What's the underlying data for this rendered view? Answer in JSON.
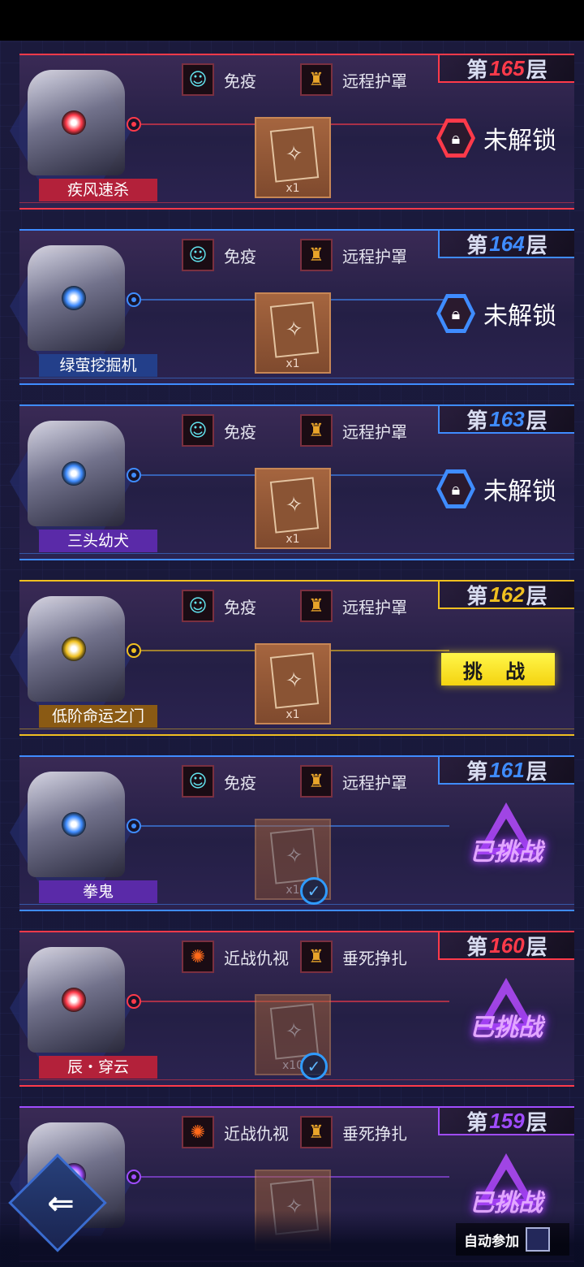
{
  "floors": [
    {
      "id": "f165",
      "prefix": "第",
      "num": "165",
      "suffix": "层",
      "boss": "疾风速杀",
      "skill1": "免疫",
      "skill2": "远程护罩",
      "skill1_icon": "immune-icon",
      "skill2_icon": "shield-icon",
      "reward_qty": "x1",
      "state": "locked",
      "state_label": "未解锁",
      "color": "#ff3a4a",
      "name_bg": "#b3213a"
    },
    {
      "id": "f164",
      "prefix": "第",
      "num": "164",
      "suffix": "层",
      "boss": "绿萤挖掘机",
      "skill1": "免疫",
      "skill2": "远程护罩",
      "skill1_icon": "immune-icon",
      "skill2_icon": "shield-icon",
      "reward_qty": "x1",
      "state": "locked",
      "state_label": "未解锁",
      "color": "#3f8cff",
      "name_bg": "#233f8a"
    },
    {
      "id": "f163",
      "prefix": "第",
      "num": "163",
      "suffix": "层",
      "boss": "三头幼犬",
      "skill1": "免疫",
      "skill2": "远程护罩",
      "skill1_icon": "immune-icon",
      "skill2_icon": "shield-icon",
      "reward_qty": "x1",
      "state": "locked",
      "state_label": "未解锁",
      "color": "#3f8cff",
      "name_bg": "#5a2aa8"
    },
    {
      "id": "f162",
      "prefix": "第",
      "num": "162",
      "suffix": "层",
      "boss": "低阶命运之门",
      "skill1": "免疫",
      "skill2": "远程护罩",
      "skill1_icon": "immune-icon",
      "skill2_icon": "shield-icon",
      "reward_qty": "x1",
      "state": "challenge",
      "state_label": "挑 战",
      "color": "#f0c020",
      "name_bg": "#8a5a14"
    },
    {
      "id": "f161",
      "prefix": "第",
      "num": "161",
      "suffix": "层",
      "boss": "拳鬼",
      "skill1": "免疫",
      "skill2": "远程护罩",
      "skill1_icon": "immune-icon",
      "skill2_icon": "shield-icon",
      "reward_qty": "x1",
      "state": "done",
      "state_label": "已挑战",
      "color": "#3f8cff",
      "name_bg": "#5a2aa8"
    },
    {
      "id": "f160",
      "prefix": "第",
      "num": "160",
      "suffix": "层",
      "boss": "辰・穿云",
      "skill1": "近战仇视",
      "skill2": "垂死挣扎",
      "skill1_icon": "melee-icon",
      "skill2_icon": "shield-icon",
      "reward_qty": "x10",
      "state": "done",
      "state_label": "已挑战",
      "color": "#ff3a4a",
      "name_bg": "#b3213a"
    },
    {
      "id": "f159",
      "prefix": "第",
      "num": "159",
      "suffix": "层",
      "boss": "",
      "skill1": "近战仇视",
      "skill2": "垂死挣扎",
      "skill1_icon": "melee-icon",
      "skill2_icon": "shield-icon",
      "reward_qty": "",
      "state": "done",
      "state_label": "已挑战",
      "color": "#a04cff",
      "name_bg": "#5a2aa8"
    }
  ],
  "auto_join_label": "自动参加",
  "back_arrow": "⇐"
}
